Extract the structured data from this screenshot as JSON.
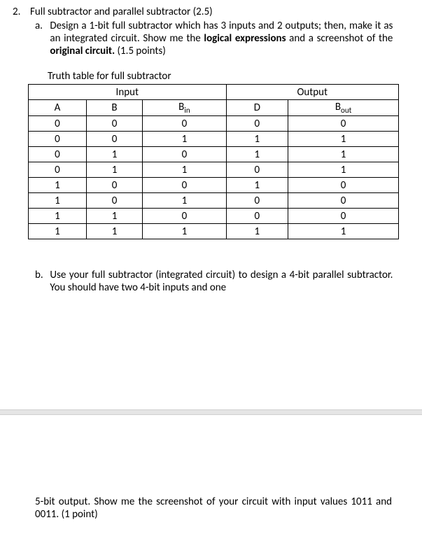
{
  "question": {
    "number": "2.",
    "title": "Full subtractor and parallel subtractor (2.5)"
  },
  "partA": {
    "letter": "a.",
    "text_before_bold1": "Design a 1-bit full subtractor which has 3 inputs and 2 outputs; then, make it as an integrated circuit. Show me the ",
    "bold1": "logical expressions",
    "text_mid": " and a screenshot of the ",
    "bold2": "original circuit.",
    "text_after": " (1.5 points)"
  },
  "table": {
    "caption": "Truth table for full subtractor",
    "header_input": "Input",
    "header_output": "Output",
    "cols": {
      "A": "A",
      "B": "B",
      "Bin": "B",
      "Bin_sub": "in",
      "D": "D",
      "Bout": "B",
      "Bout_sub": "out"
    },
    "rows": [
      {
        "A": "0",
        "B": "0",
        "Bin": "0",
        "D": "0",
        "Bout": "0"
      },
      {
        "A": "0",
        "B": "0",
        "Bin": "1",
        "D": "1",
        "Bout": "1"
      },
      {
        "A": "0",
        "B": "1",
        "Bin": "0",
        "D": "1",
        "Bout": "1"
      },
      {
        "A": "0",
        "B": "1",
        "Bin": "1",
        "D": "0",
        "Bout": "1"
      },
      {
        "A": "1",
        "B": "0",
        "Bin": "0",
        "D": "1",
        "Bout": "0"
      },
      {
        "A": "1",
        "B": "0",
        "Bin": "1",
        "D": "0",
        "Bout": "0"
      },
      {
        "A": "1",
        "B": "1",
        "Bin": "0",
        "D": "0",
        "Bout": "0"
      },
      {
        "A": "1",
        "B": "1",
        "Bin": "1",
        "D": "1",
        "Bout": "1"
      }
    ]
  },
  "partB": {
    "letter": "b.",
    "text": "Use your full subtractor (integrated circuit) to design a 4-bit parallel subtractor.  You should have two 4-bit inputs and one"
  },
  "continuation": {
    "text": "5-bit output. Show me the screenshot of your circuit with input values 1011 and 0011. (1 point)"
  }
}
